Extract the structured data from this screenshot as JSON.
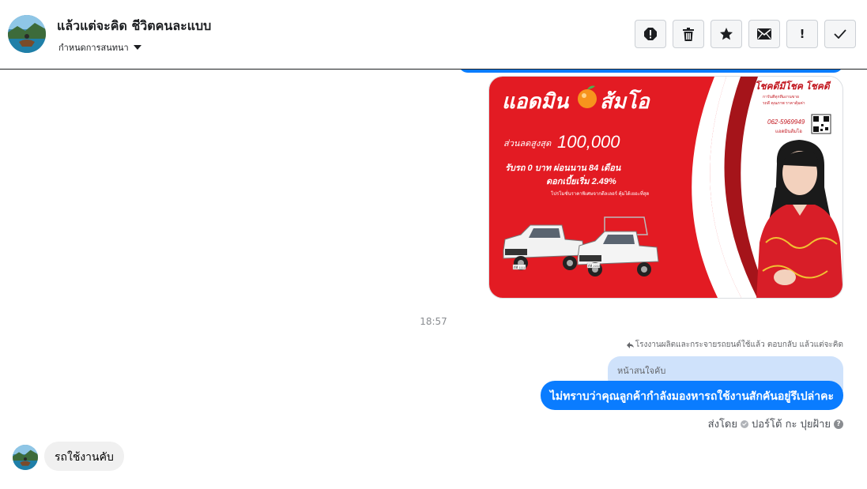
{
  "header": {
    "contact_name": "แล้วแต่จะคิด ชีวิตคนละแบบ",
    "assign_label": "กำหนดการสนทนา"
  },
  "toolbar": [
    {
      "name": "spam-button",
      "icon": "alert-circle-icon"
    },
    {
      "name": "delete-button",
      "icon": "trash-icon"
    },
    {
      "name": "star-button",
      "icon": "star-icon"
    },
    {
      "name": "mark-unread-button",
      "icon": "envelope-icon"
    },
    {
      "name": "follow-up-button",
      "icon": "exclamation-icon",
      "glyph": "!"
    },
    {
      "name": "mark-done-button",
      "icon": "checkmark-icon"
    }
  ],
  "ad_card": {
    "brand": "แอดมิน",
    "brand_suffix": "ส้มโอ",
    "discount_label": "ส่วนลดสูงสุด",
    "discount_value": "100,000",
    "down_payment": "รับรถ 0 บาท ผ่อนนาน 84 เดือน",
    "interest": "ดอกเบี้ยเริ่ม 2.49%",
    "promo_note": "โปรโมชั่นราคาพิเศษจากดีลเลอร์ คุ้มได้เยอะที่สุด",
    "lucky_text": "โชคดีมีโชค โชคดี",
    "small_text_1": "การันตีทุกทีมงานขาย",
    "small_text_2": "รถดี คุณภาพ ราคาคุ้มค่า",
    "phone": "062-5969949",
    "line_id": "แอดมินส้มโอ",
    "plate_1": "ดีพี 1111",
    "plate_2": "ดีพี 2222",
    "colors": {
      "red": "#e31b23",
      "dark_red": "#a5141a",
      "white": "#ffffff"
    }
  },
  "thread": {
    "timestamp": "18:57",
    "reply_context": "โรงงานผลิตและกระจายรถยนต์ใช้แล้ว ตอบกลับ แล้วแต่จะคิด",
    "quoted_text": "หน้าสนใจคับ",
    "outgoing_message": "ไม่ทราบว่าคุณลูกค้ากำลังมองหารถใช้งานสักคันอยู่รึเปล่าคะ",
    "sent_by_label": "ส่งโดย",
    "sent_by_name": "ปอร์โต้ กะ ปุยฝ้าย",
    "incoming_message": "รถใช้งานคับ"
  },
  "colors": {
    "accent": "#0a7cff",
    "quoted_bg": "#cfe2fb",
    "incoming_bg": "#f0f0f0"
  }
}
